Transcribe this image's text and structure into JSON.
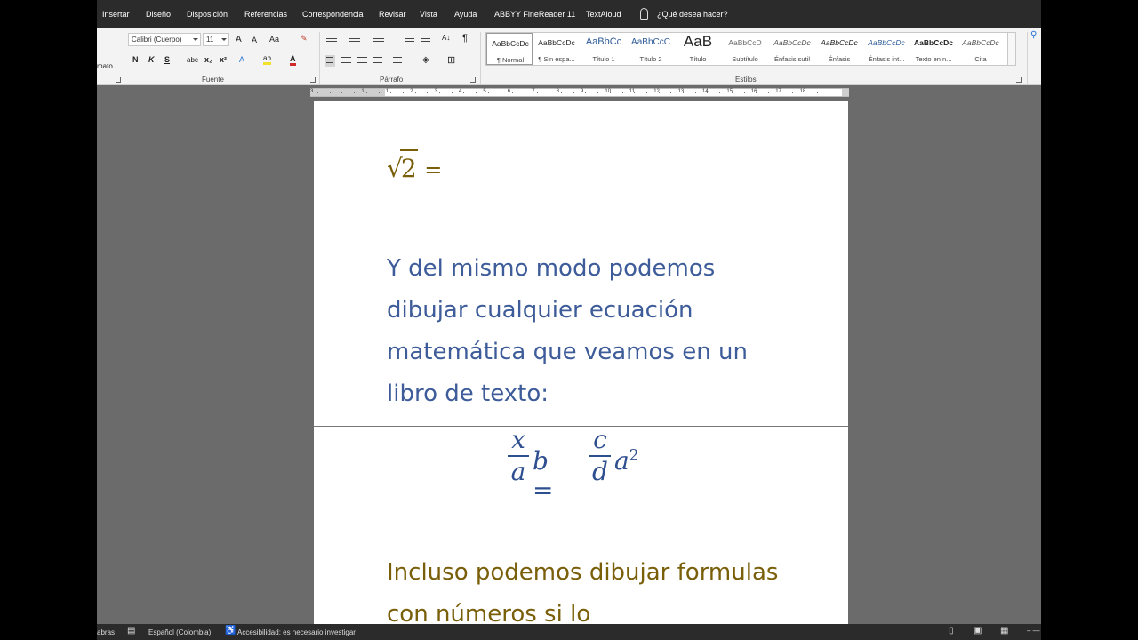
{
  "menu": {
    "tabs": [
      "Insertar",
      "Diseño",
      "Disposición",
      "Referencias",
      "Correspondencia",
      "Revisar",
      "Vista",
      "Ayuda",
      "ABBYY FineReader 11",
      "TextAloud"
    ],
    "search": "¿Qué desea hacer?"
  },
  "ribbon": {
    "clipboard_fragment": "mato",
    "font_name": "Calibri (Cuerpo)",
    "font_size": "11",
    "grow_font": "A",
    "shrink_font": "A",
    "change_case": "Aa",
    "bold": "N",
    "italic": "K",
    "underline": "S",
    "strikethrough": "abc",
    "subscript": "x₂",
    "superscript": "x²",
    "highlight": "ab",
    "font_color": "A",
    "pilcrow": "¶",
    "groups": {
      "font": "Fuente",
      "paragraph": "Párrafo",
      "styles": "Estilos"
    },
    "styles": [
      {
        "sample": "AaBbCcDc",
        "name": "¶ Normal"
      },
      {
        "sample": "AaBbCcDc",
        "name": "¶ Sin espa..."
      },
      {
        "sample": "AaBbCc",
        "name": "Título 1"
      },
      {
        "sample": "AaBbCcC",
        "name": "Título 2"
      },
      {
        "sample": "AaB",
        "name": "Título"
      },
      {
        "sample": "AaBbCcD",
        "name": "Subtítulo"
      },
      {
        "sample": "AaBbCcDc",
        "name": "Énfasis sutil"
      },
      {
        "sample": "AaBbCcDc",
        "name": "Énfasis"
      },
      {
        "sample": "AaBbCcDc",
        "name": "Énfasis int..."
      },
      {
        "sample": "AaBbCcDc",
        "name": "Texto en n..."
      },
      {
        "sample": "AaBbCcDc",
        "name": "Cita"
      }
    ]
  },
  "ruler": {
    "numbers": [
      "3",
      "1",
      "1",
      "2",
      "3",
      "4",
      "5",
      "6",
      "7",
      "8",
      "9",
      "10",
      "11",
      "12",
      "13",
      "14",
      "15",
      "16",
      "17",
      "18"
    ]
  },
  "document": {
    "line1_radicand": "2",
    "line1_rest": " =",
    "para2": "Y del mismo modo podemos dibujar cualquier ecuación matemática que veamos en un libro de texto:",
    "equation": {
      "frac1_num": "x",
      "frac1_den": "a",
      "middle": "b =",
      "frac2_num": "c",
      "frac2_den": "d",
      "tail_base": "a",
      "tail_exp": "2"
    },
    "para3": "Incluso podemos dibujar formulas con números si lo"
  },
  "status": {
    "words": "abras",
    "language": "Español (Colombia)",
    "accessibility": "Accesibilidad: es necesario investigar"
  },
  "colors": {
    "title_text": "#7a5f0a",
    "body_text": "#3d5c99",
    "equation": "#2e4f8f",
    "menubar": "#2b2b2b"
  }
}
